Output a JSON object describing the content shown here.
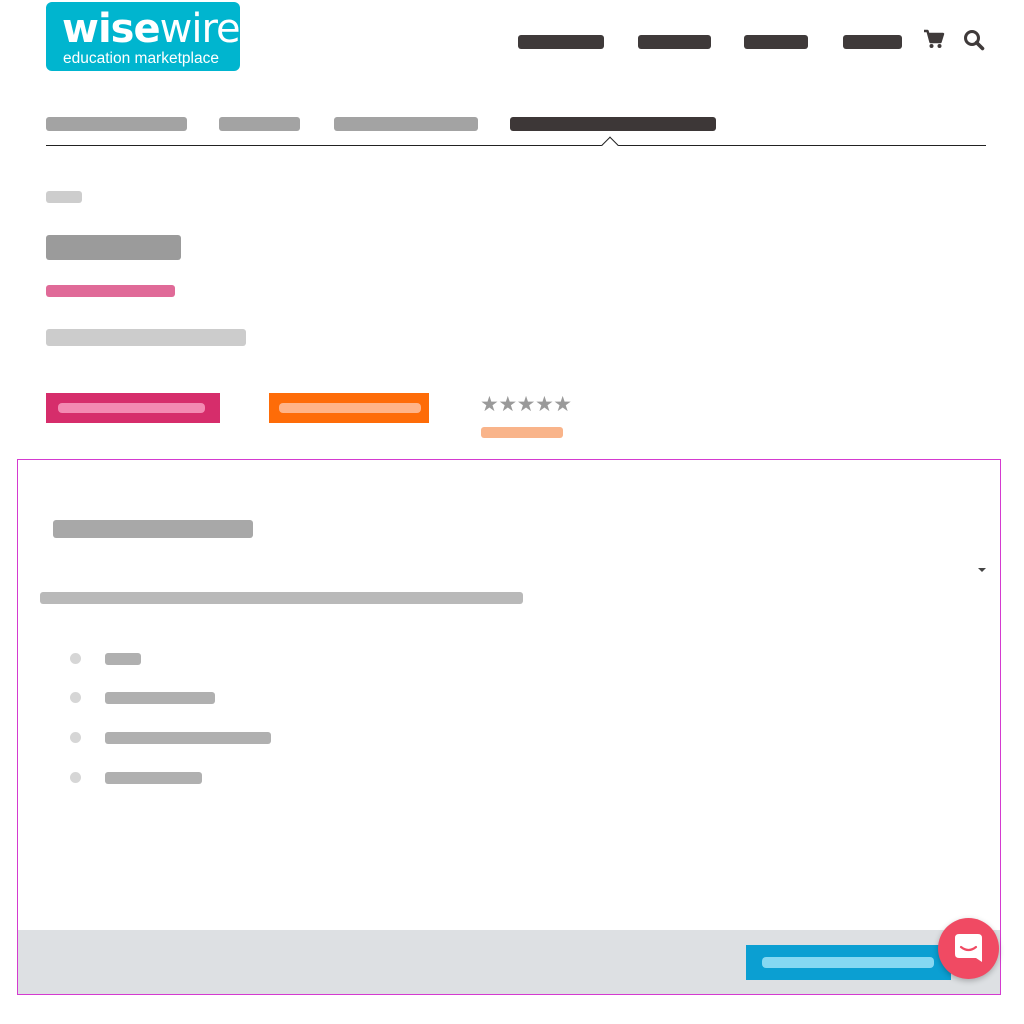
{
  "logo": {
    "word_bold": "wise",
    "word_light": "wire",
    "tagline": "education marketplace"
  },
  "header": {
    "nav_items": [
      {
        "label": ""
      },
      {
        "label": ""
      },
      {
        "label": ""
      },
      {
        "label": ""
      }
    ],
    "cart_icon": "shopping-cart-icon",
    "search_icon": "search-icon"
  },
  "tabs": [
    {
      "label": ""
    },
    {
      "label": ""
    },
    {
      "label": ""
    },
    {
      "label": "",
      "active": true
    }
  ],
  "product": {
    "breadcrumb": "",
    "title": "",
    "author": "",
    "subtitle": "",
    "primary_button_label": "",
    "secondary_button_label": "",
    "rating_stars": "★★★★★",
    "rating_value": 0,
    "review_link": ""
  },
  "panel": {
    "heading": "",
    "description": "",
    "list_items": [
      {
        "label": ""
      },
      {
        "label": ""
      },
      {
        "label": ""
      },
      {
        "label": ""
      }
    ],
    "footer_button_label": ""
  },
  "colors": {
    "brand": "#00b5cf",
    "primary_button": "#d62d6b",
    "secondary_button": "#fe6c08",
    "footer_button": "#0b9fd2",
    "chat_bubble": "#f04a63",
    "panel_border": "#d43ad0"
  },
  "chat": {
    "icon": "chat-bubble-icon"
  }
}
